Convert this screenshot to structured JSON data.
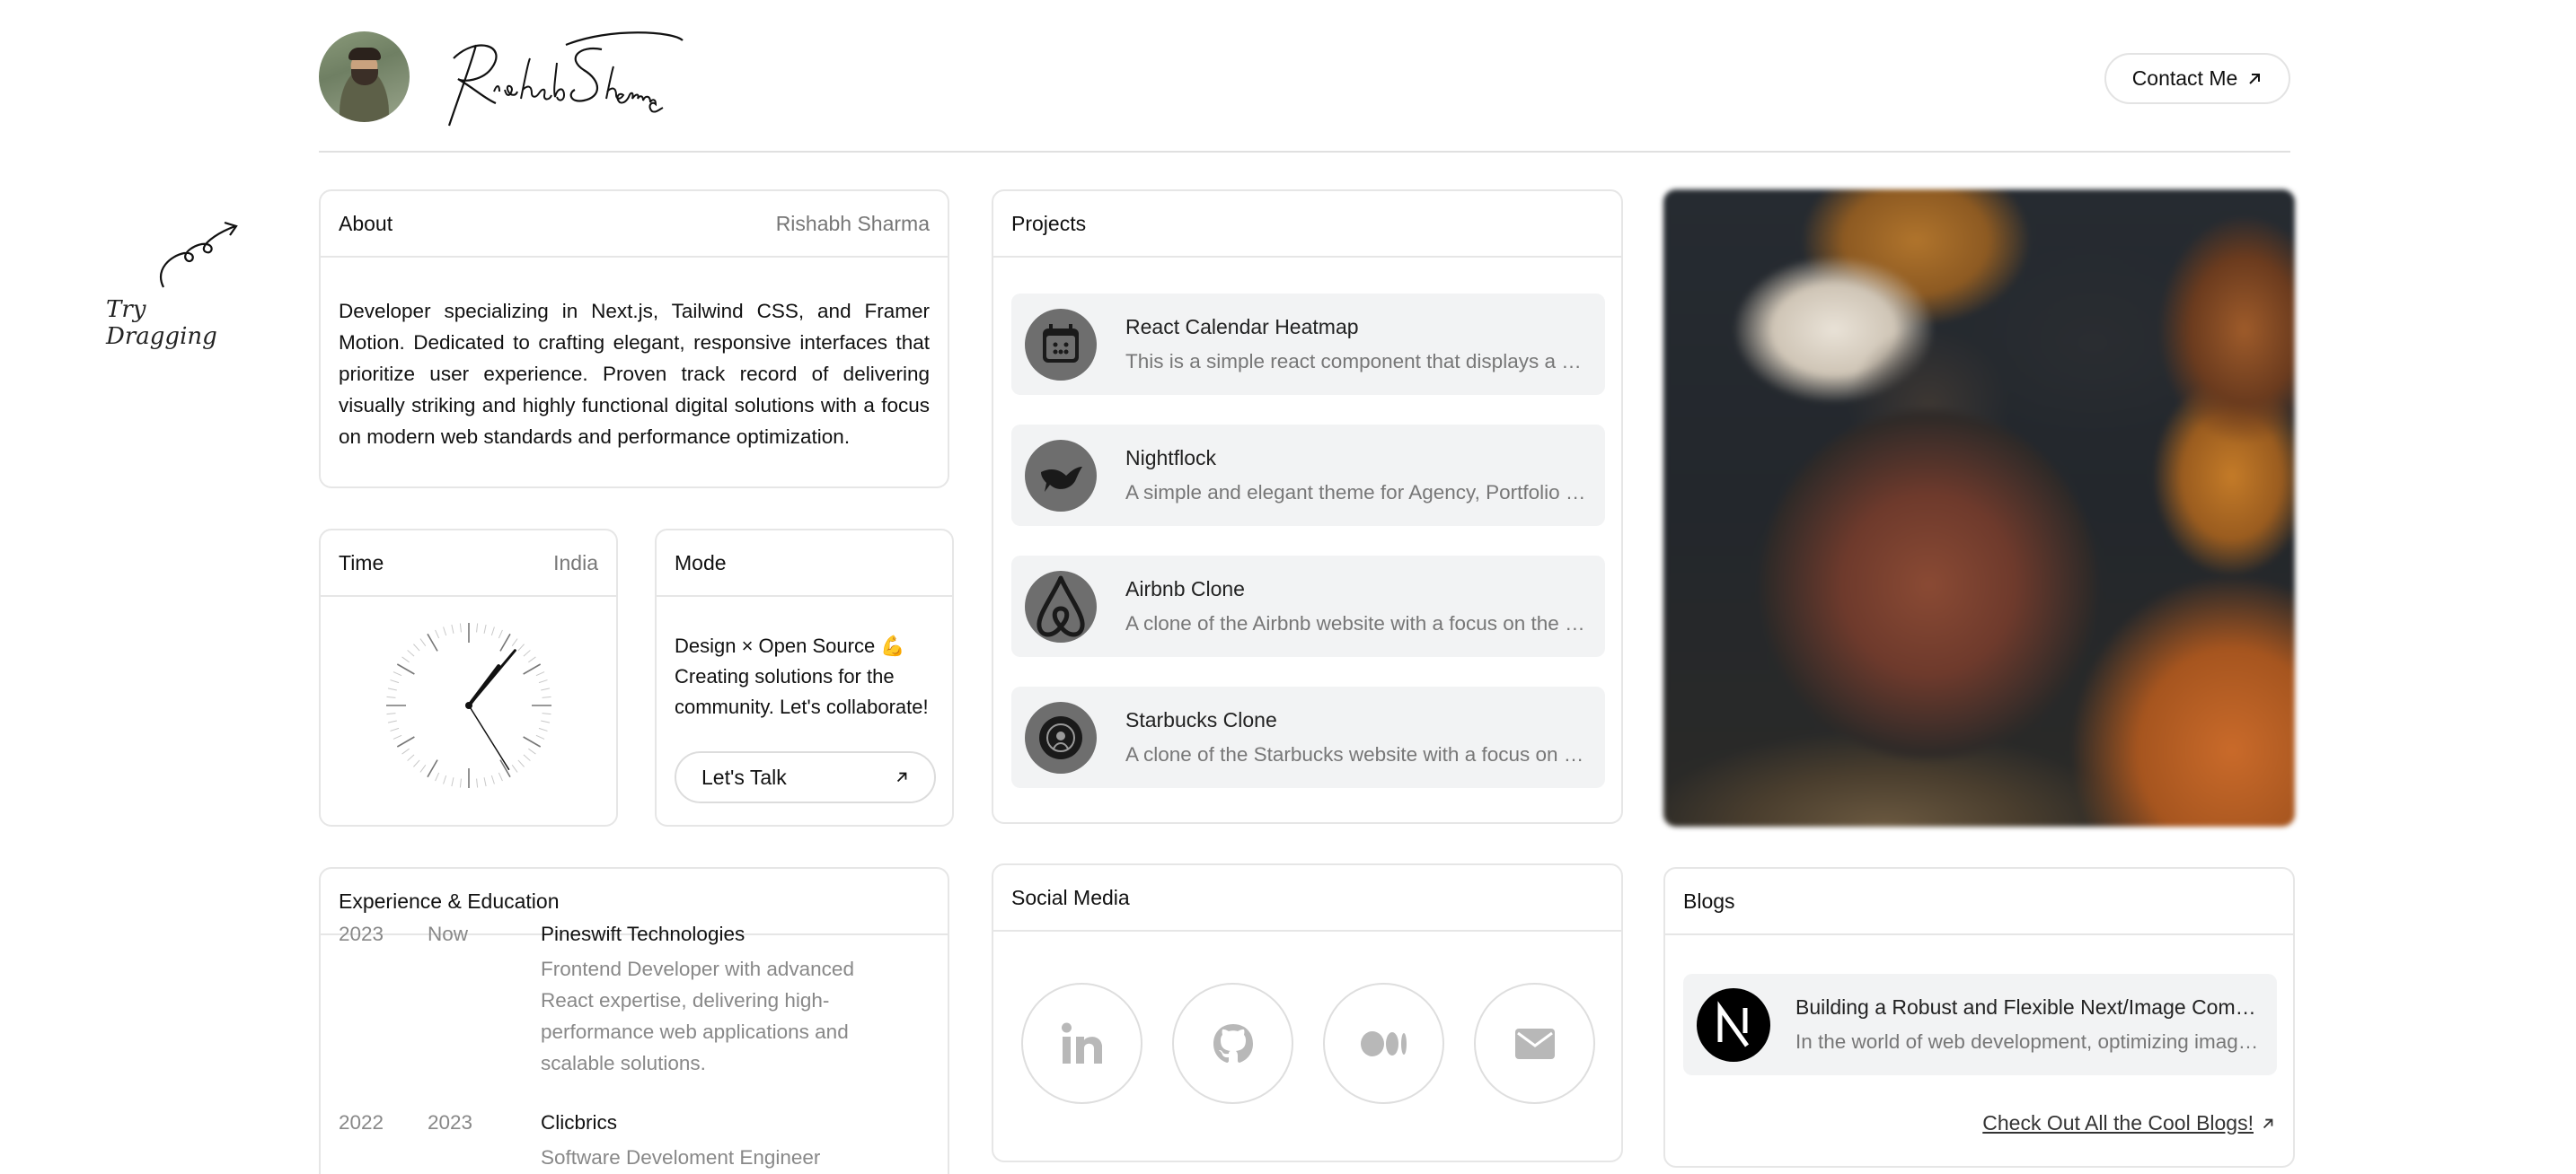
{
  "header": {
    "name_signature": "Rishabh Sharma",
    "contact_label": "Contact Me"
  },
  "drag_hint": "Try Dragging",
  "about": {
    "title": "About",
    "subtitle": "Rishabh Sharma",
    "text": "Developer specializing in Next.js, Tailwind CSS, and Framer Motion. Dedicated to crafting elegant, responsive interfaces that prioritize user experience. Proven track record of delivering visually striking and highly functional digital solutions with a focus on modern web standards and performance optimization."
  },
  "time": {
    "title": "Time",
    "subtitle": "India"
  },
  "mode": {
    "title": "Mode",
    "text": "Design × Open Source 💪 Creating solutions for the community. Let's collaborate!",
    "button": "Let's Talk"
  },
  "projects": {
    "title": "Projects",
    "items": [
      {
        "title": "React Calendar Heatmap",
        "desc": "This is a simple react component that displays a calendar heatmap",
        "icon": "calendar-icon"
      },
      {
        "title": "Nightflock",
        "desc": "A simple and elegant theme for Agency, Portfolio websites",
        "icon": "bird-icon"
      },
      {
        "title": "Airbnb Clone",
        "desc": "A clone of the Airbnb website with a focus on the design",
        "icon": "airbnb-icon"
      },
      {
        "title": "Starbucks Clone",
        "desc": "A clone of the Starbucks website with a focus on the design",
        "icon": "starbucks-icon"
      }
    ]
  },
  "experience": {
    "title": "Experience & Education",
    "items": [
      {
        "from": "2023",
        "to": "Now",
        "title": "Pineswift Technologies",
        "desc": "Frontend Developer with advanced React expertise, delivering high-performance web applications and scalable solutions."
      },
      {
        "from": "2022",
        "to": "2023",
        "title": "Clicbrics",
        "desc": "Software Develoment Engineer"
      }
    ]
  },
  "social": {
    "title": "Social Media",
    "items": [
      "linkedin-icon",
      "github-icon",
      "medium-icon",
      "mail-icon"
    ]
  },
  "blogs": {
    "title": "Blogs",
    "item": {
      "title": "Building a Robust and Flexible Next/Image Component",
      "desc": "In the world of web development, optimizing images is essential"
    },
    "link": "Check Out All the Cool Blogs!"
  }
}
